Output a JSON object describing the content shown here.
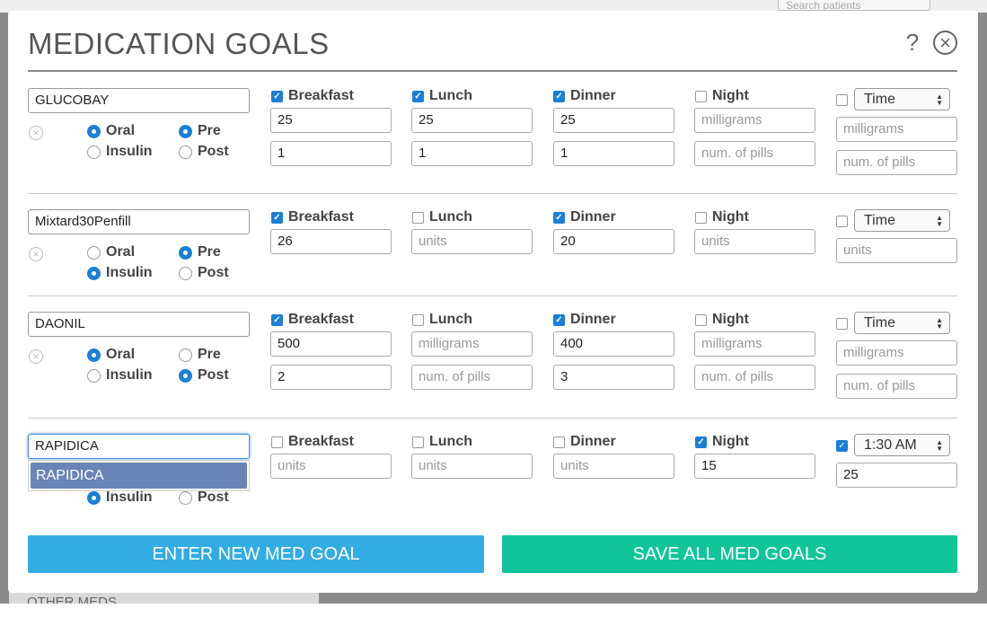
{
  "app": {
    "search_placeholder": "Search patients",
    "other_meds_label": "OTHER MEDS"
  },
  "modal": {
    "title": "MEDICATION GOALS",
    "help_icon": "question-icon",
    "close_icon": "close-circle-icon"
  },
  "meds": [
    {
      "name": "GLUCOBAY",
      "type_oral_label": "Oral",
      "type_insulin_label": "Insulin",
      "type_selected": "Oral",
      "timing_pre_label": "Pre",
      "timing_post_label": "Post",
      "timing_selected": "Pre",
      "breakfast": {
        "label": "Breakfast",
        "checked": true,
        "amount": "25",
        "pills": "1"
      },
      "lunch": {
        "label": "Lunch",
        "checked": true,
        "amount": "25",
        "pills": "1"
      },
      "dinner": {
        "label": "Dinner",
        "checked": true,
        "amount": "25",
        "pills": "1"
      },
      "night": {
        "label": "Night",
        "checked": false,
        "amount_placeholder": "milligrams",
        "pills_placeholder": "num. of pills"
      },
      "custom": {
        "checked": false,
        "time": "Time",
        "amount_placeholder": "milligrams",
        "pills_placeholder": "num. of pills"
      }
    },
    {
      "name": "Mixtard30Penfill",
      "type_oral_label": "Oral",
      "type_insulin_label": "Insulin",
      "type_selected": "Insulin",
      "timing_pre_label": "Pre",
      "timing_post_label": "Post",
      "timing_selected": "Pre",
      "breakfast": {
        "label": "Breakfast",
        "checked": true,
        "amount": "26"
      },
      "lunch": {
        "label": "Lunch",
        "checked": false,
        "amount_placeholder": "units"
      },
      "dinner": {
        "label": "Dinner",
        "checked": true,
        "amount": "20"
      },
      "night": {
        "label": "Night",
        "checked": false,
        "amount_placeholder": "units"
      },
      "custom": {
        "checked": false,
        "time": "Time",
        "amount_placeholder": "units"
      }
    },
    {
      "name": "DAONIL",
      "type_oral_label": "Oral",
      "type_insulin_label": "Insulin",
      "type_selected": "Oral",
      "timing_pre_label": "Pre",
      "timing_post_label": "Post",
      "timing_selected": "Post",
      "breakfast": {
        "label": "Breakfast",
        "checked": true,
        "amount": "500",
        "pills": "2"
      },
      "lunch": {
        "label": "Lunch",
        "checked": false,
        "amount_placeholder": "milligrams",
        "pills_placeholder": "num. of pills"
      },
      "dinner": {
        "label": "Dinner",
        "checked": true,
        "amount": "400",
        "pills": "3"
      },
      "night": {
        "label": "Night",
        "checked": false,
        "amount_placeholder": "milligrams",
        "pills_placeholder": "num. of pills"
      },
      "custom": {
        "checked": false,
        "time": "Time",
        "amount_placeholder": "milligrams",
        "pills_placeholder": "num. of pills"
      }
    },
    {
      "name": "RAPIDICA",
      "autocomplete_suggestion": "RAPIDICA",
      "type_insulin_label": "Insulin",
      "type_selected": "Insulin",
      "timing_post_label": "Post",
      "timing_selected": "Pre",
      "breakfast": {
        "label": "Breakfast",
        "checked": false,
        "amount_placeholder": "units"
      },
      "lunch": {
        "label": "Lunch",
        "checked": false,
        "amount_placeholder": "units"
      },
      "dinner": {
        "label": "Dinner",
        "checked": false,
        "amount_placeholder": "units"
      },
      "night": {
        "label": "Night",
        "checked": true,
        "amount": "15"
      },
      "custom": {
        "checked": true,
        "time": "1:30 AM",
        "amount": "25"
      }
    }
  ],
  "buttons": {
    "new_label": "ENTER NEW MED GOAL",
    "save_label": "SAVE ALL MED GOALS"
  },
  "colors": {
    "accent_blue": "#1a7fd6",
    "new_button": "#33ace3",
    "save_button": "#11c59a",
    "autocomplete_highlight": "#6a84b8"
  }
}
